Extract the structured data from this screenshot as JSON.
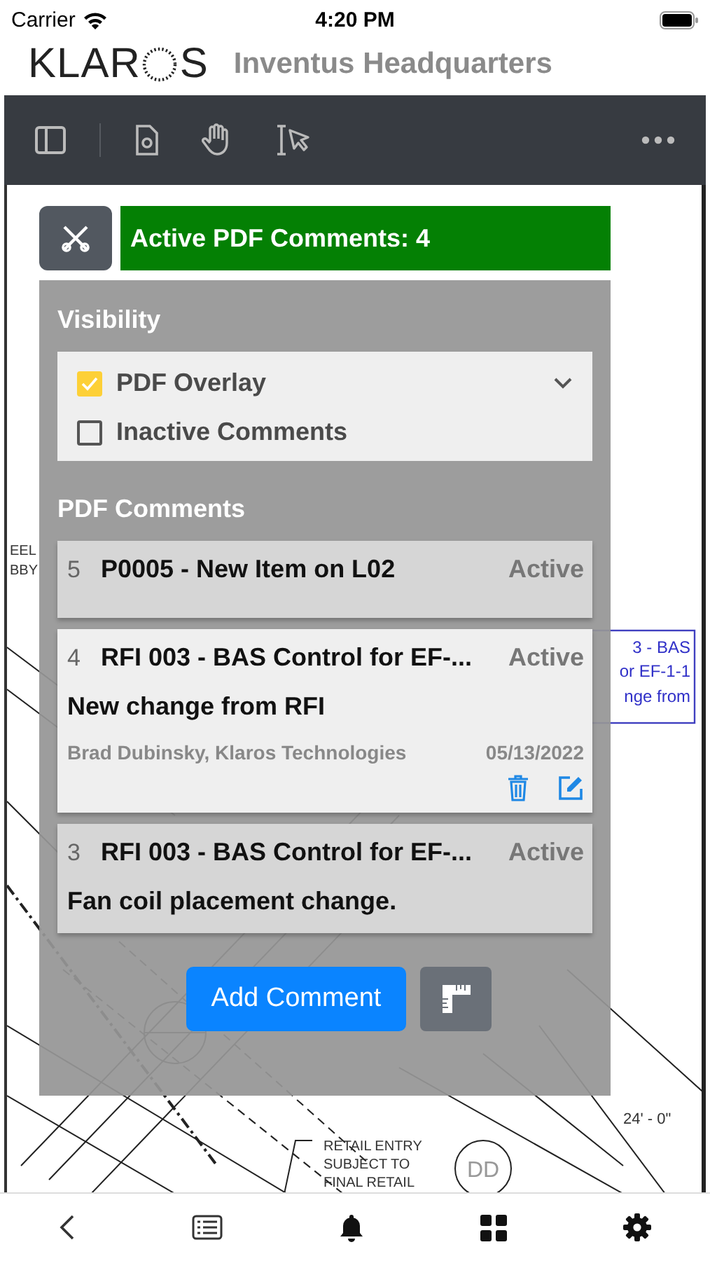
{
  "status_bar": {
    "carrier": "Carrier",
    "time": "4:20 PM"
  },
  "header": {
    "logo": "KLAR",
    "logo_end": "S",
    "title": "Inventus Headquarters"
  },
  "document": {
    "texts": [
      {
        "kind": "note",
        "text": "EEL"
      },
      {
        "kind": "note",
        "text": "BBY"
      },
      {
        "kind": "markup",
        "text": "3 - BAS"
      },
      {
        "kind": "markup",
        "text": "or EF-1-1"
      },
      {
        "kind": "markup",
        "text": "nge from"
      },
      {
        "kind": "tag",
        "text": "DD"
      },
      {
        "kind": "note",
        "text": "RETAIL ENTRY"
      },
      {
        "kind": "note",
        "text": "SUBJECT TO"
      },
      {
        "kind": "note",
        "text": "FINAL RETAIL"
      },
      {
        "kind": "dimension",
        "text": "24' - 0\""
      }
    ]
  },
  "panel": {
    "banner": "Active PDF Comments: 4",
    "visibility_label": "Visibility",
    "options": [
      {
        "label": "PDF Overlay",
        "checked": true,
        "expandable": true
      },
      {
        "label": "Inactive Comments",
        "checked": false,
        "expandable": false
      }
    ],
    "comments_label": "PDF Comments",
    "comments": [
      {
        "number": "5",
        "title": "P0005 - New Item on L02",
        "status": "Active",
        "selected": false
      },
      {
        "number": "4",
        "title": "RFI 003 - BAS Control for EF-...",
        "status": "Active",
        "body": "New change from RFI",
        "author": "Brad Dubinsky, Klaros Technologies",
        "date": "05/13/2022",
        "selected": true
      },
      {
        "number": "3",
        "title": "RFI 003 - BAS Control for EF-...",
        "status": "Active",
        "body": "Fan coil placement change.",
        "selected": false
      }
    ],
    "add_button": "Add Comment"
  }
}
